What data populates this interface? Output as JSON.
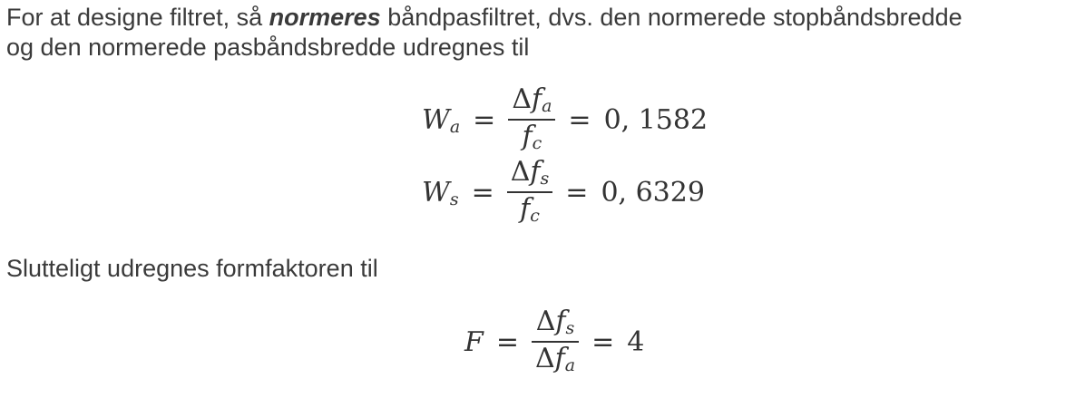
{
  "intro": {
    "before": "For at designe filtret, så ",
    "emphasis": "normeres",
    "after_line1": " båndpasfiltret, dvs. den normerede stopbåndsbredde",
    "line2": "og den normerede pasbåndsbredde udregnes til"
  },
  "equations": {
    "wa": {
      "lhs": "W",
      "lhs_sub": "a",
      "num": "f",
      "num_sub": "a",
      "den": "f",
      "den_sub": "c",
      "value": "0, 1582"
    },
    "ws": {
      "lhs": "W",
      "lhs_sub": "s",
      "num": "f",
      "num_sub": "s",
      "den": "f",
      "den_sub": "c",
      "value": "0, 6329"
    },
    "f": {
      "lhs": "F",
      "num": "f",
      "num_sub": "s",
      "den": "f",
      "den_sub": "a",
      "value": "4"
    }
  },
  "symbols": {
    "delta": "Δ",
    "equals": "="
  },
  "outro": "Slutteligt udregnes formfaktoren til"
}
